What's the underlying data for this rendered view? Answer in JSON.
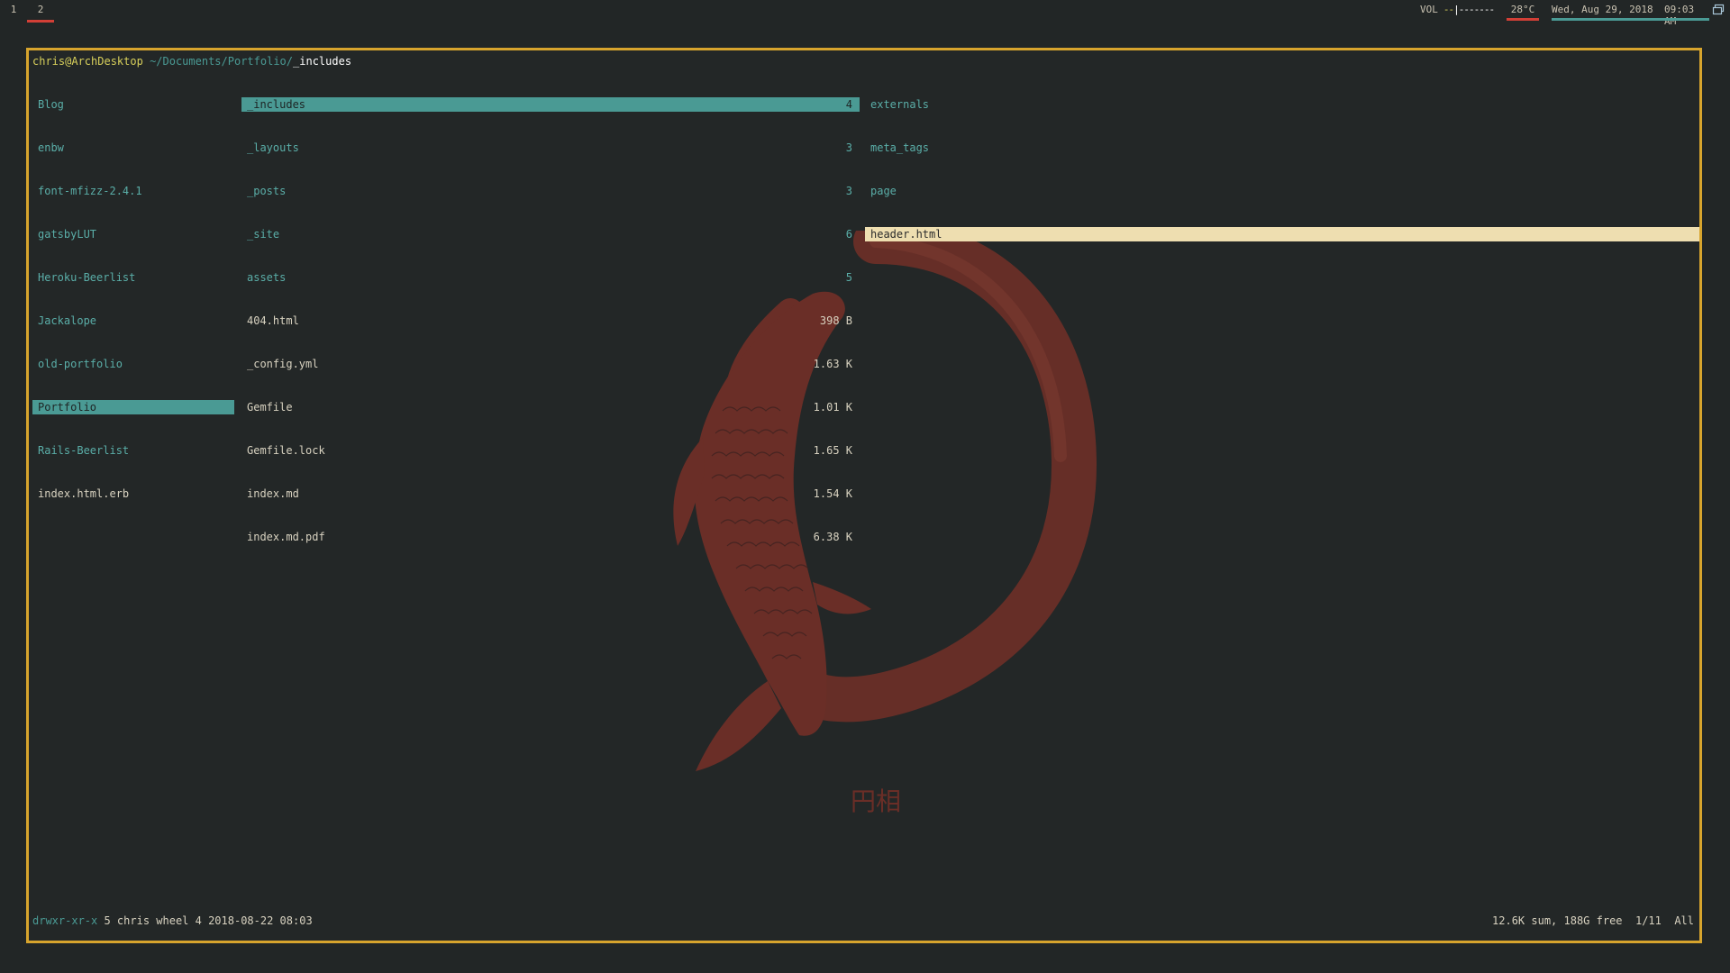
{
  "bar": {
    "workspaces": [
      "1",
      "2"
    ],
    "active_workspace": "2",
    "volume_label": "VOL",
    "volume_filled": "--",
    "volume_rest": "|-------",
    "temperature": "28°C",
    "date": "Wed, Aug 29, 2018",
    "time": "09:03 AM",
    "tray_icon": "screen-icon"
  },
  "terminal": {
    "path": {
      "user_host": "chris@ArchDesktop",
      "dir": "~/Documents/Portfolio/",
      "current": "_includes"
    },
    "left_column": [
      {
        "name": "Blog",
        "type": "dir"
      },
      {
        "name": "enbw",
        "type": "dir"
      },
      {
        "name": "font-mfizz-2.4.1",
        "type": "dir"
      },
      {
        "name": "gatsbyLUT",
        "type": "dir"
      },
      {
        "name": "Heroku-Beerlist",
        "type": "dir"
      },
      {
        "name": "Jackalope",
        "type": "dir"
      },
      {
        "name": "old-portfolio",
        "type": "dir"
      },
      {
        "name": "Portfolio",
        "type": "dir",
        "selected": true
      },
      {
        "name": "Rails-Beerlist",
        "type": "dir"
      },
      {
        "name": "index.html.erb",
        "type": "file"
      }
    ],
    "middle_column": [
      {
        "name": "_includes",
        "size": "4",
        "type": "dir",
        "selected": true
      },
      {
        "name": "_layouts",
        "size": "3",
        "type": "dir"
      },
      {
        "name": "_posts",
        "size": "3",
        "type": "dir"
      },
      {
        "name": "_site",
        "size": "6",
        "type": "dir"
      },
      {
        "name": "assets",
        "size": "5",
        "type": "dir"
      },
      {
        "name": "404.html",
        "size": "398 B",
        "type": "file"
      },
      {
        "name": "_config.yml",
        "size": "1.63 K",
        "type": "file"
      },
      {
        "name": "Gemfile",
        "size": "1.01 K",
        "type": "file"
      },
      {
        "name": "Gemfile.lock",
        "size": "1.65 K",
        "type": "file"
      },
      {
        "name": "index.md",
        "size": "1.54 K",
        "type": "file"
      },
      {
        "name": "index.md.pdf",
        "size": "6.38 K",
        "type": "file"
      }
    ],
    "right_column": [
      {
        "name": "externals",
        "type": "dir"
      },
      {
        "name": "meta_tags",
        "type": "dir"
      },
      {
        "name": "page",
        "type": "dir"
      },
      {
        "name": "header.html",
        "type": "file",
        "selected": true
      }
    ],
    "status": {
      "permissions": "drwxr-xr-x",
      "details": " 5 chris wheel 4 2018-08-22 08:03",
      "summary": "12.6K sum, 188G free  1/11  All"
    },
    "wallpaper_caption": "円相"
  },
  "colors": {
    "accent_border": "#d7a42d",
    "dir_color": "#5aaea8",
    "selection_dir": "#4a9a94",
    "selection_file": "#eedeb0",
    "alert_red": "#d23f36",
    "wallpaper_red": "#6a2e27"
  }
}
